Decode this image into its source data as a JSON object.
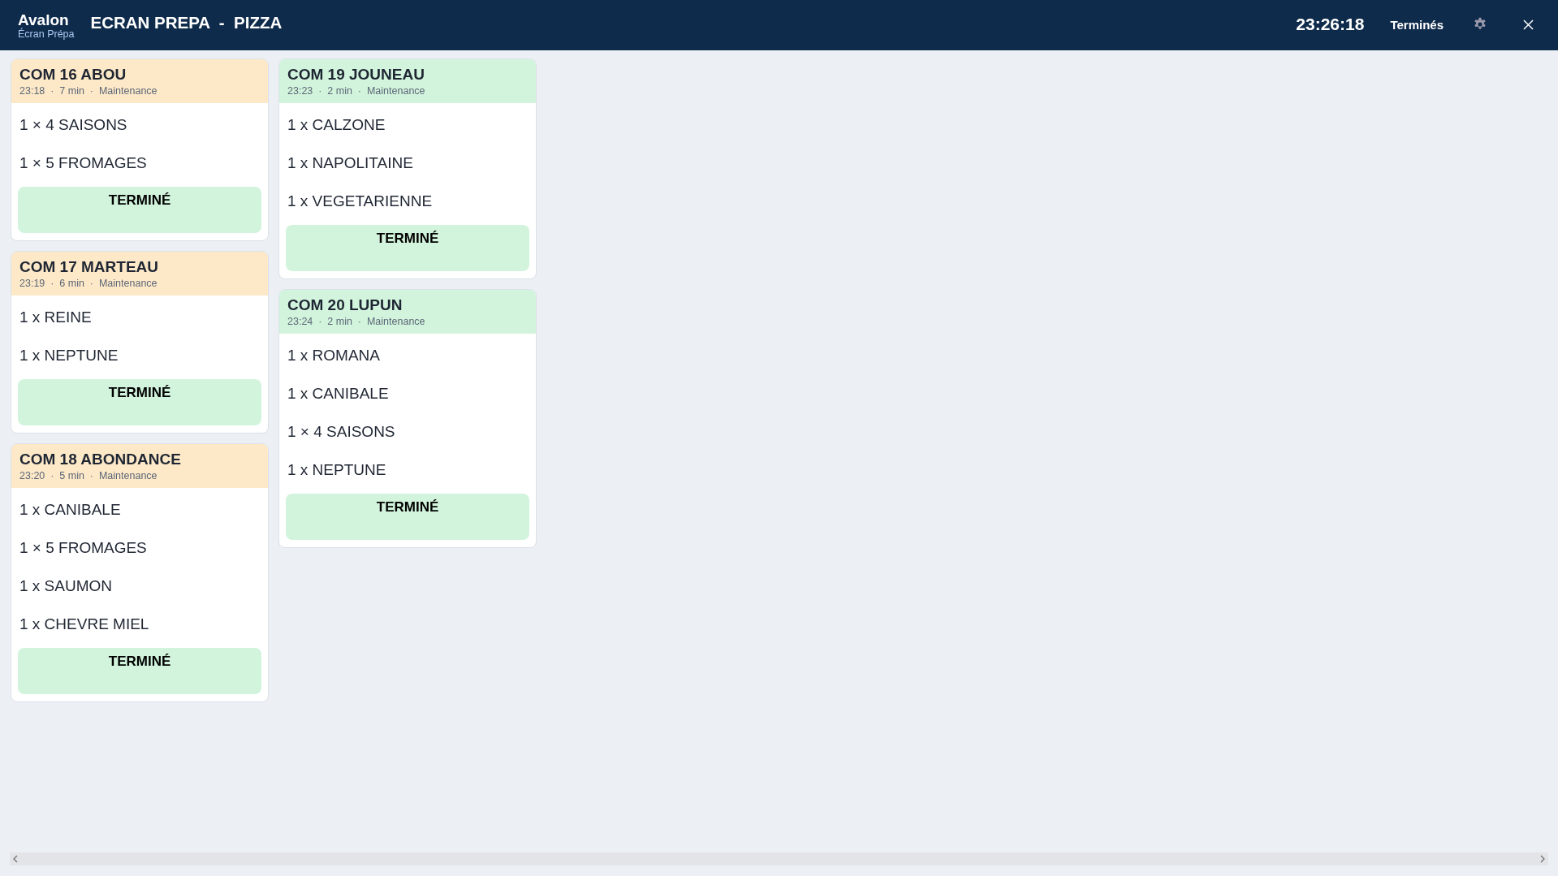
{
  "header": {
    "brand": "Avalon",
    "subtitle": "Écran Prépa",
    "title": "ECRAN PREPA  -  PIZZA",
    "clock": "23:26:18",
    "completed_button": "Terminés"
  },
  "columns": [
    {
      "orders": [
        {
          "title": "COM 16 ABOU",
          "meta": "23:18  ·  7 min  ·  Maintenance",
          "color": "#fde9c8",
          "items": [
            "1 × 4 SAISONS",
            "1 × 5 FROMAGES"
          ],
          "button": "TERMINÉ"
        },
        {
          "title": "COM 17 MARTEAU",
          "meta": "23:19  ·  6 min  ·  Maintenance",
          "color": "#fde9c8",
          "items": [
            "1 x REINE",
            "1 x NEPTUNE"
          ],
          "button": "TERMINÉ"
        },
        {
          "title": "COM 18 ABONDANCE",
          "meta": "23:20  ·  5 min  ·  Maintenance",
          "color": "#fde9c8",
          "items": [
            "1 x CANIBALE",
            "1 × 5 FROMAGES",
            "1 x SAUMON",
            "1 x CHEVRE MIEL"
          ],
          "button": "TERMINÉ"
        }
      ]
    },
    {
      "orders": [
        {
          "title": "COM 19 JOUNEAU",
          "meta": "23:23  ·  2 min  ·  Maintenance",
          "color": "#d2f4dc",
          "items": [
            "1 x CALZONE",
            "1 x NAPOLITAINE",
            "1 x VEGETARIENNE"
          ],
          "button": "TERMINÉ"
        },
        {
          "title": "COM 20 LUPUN",
          "meta": "23:24  ·  2 min  ·  Maintenance",
          "color": "#d2f4dc",
          "items": [
            "1 x ROMANA",
            "1 x CANIBALE",
            "1 × 4 SAISONS",
            "1 x NEPTUNE"
          ],
          "button": "TERMINÉ"
        }
      ]
    }
  ]
}
